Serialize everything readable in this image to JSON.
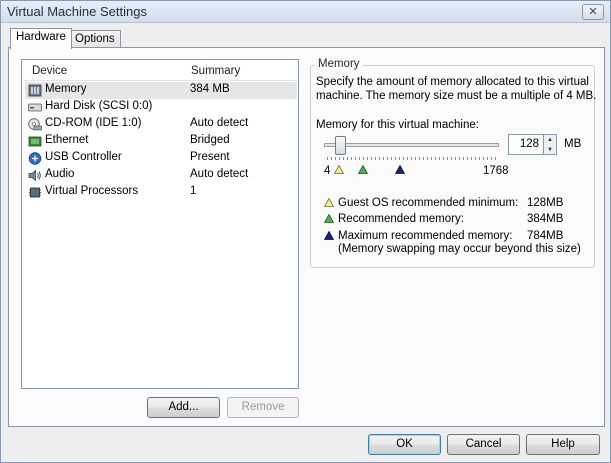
{
  "window": {
    "title": "Virtual Machine Settings",
    "close_glyph": "✕"
  },
  "tabs": [
    {
      "label": "Hardware",
      "active": true
    },
    {
      "label": "Options",
      "active": false
    }
  ],
  "device_list": {
    "columns": {
      "device": "Device",
      "summary": "Summary"
    },
    "rows": [
      {
        "name": "Memory",
        "summary": "384 MB",
        "icon": "memory-icon",
        "selected": true
      },
      {
        "name": "Hard Disk (SCSI 0:0)",
        "summary": "",
        "icon": "hard-disk-icon"
      },
      {
        "name": "CD-ROM (IDE 1:0)",
        "summary": "Auto detect",
        "icon": "cdrom-icon"
      },
      {
        "name": "Ethernet",
        "summary": "Bridged",
        "icon": "ethernet-icon"
      },
      {
        "name": "USB Controller",
        "summary": "Present",
        "icon": "usb-icon"
      },
      {
        "name": "Audio",
        "summary": "Auto detect",
        "icon": "audio-icon"
      },
      {
        "name": "Virtual Processors",
        "summary": "1",
        "icon": "processor-icon"
      }
    ]
  },
  "buttons": {
    "add": "Add...",
    "remove": "Remove",
    "ok": "OK",
    "cancel": "Cancel",
    "help": "Help"
  },
  "memory": {
    "group_label": "Memory",
    "description_line1": "Specify the amount of memory allocated to this virtual",
    "description_line2": "machine. The memory size must be a multiple of 4 MB.",
    "field_label": "Memory for this virtual machine:",
    "value": "128",
    "unit": "MB",
    "slider_min": "4",
    "slider_max": "1768",
    "slider_value": 128,
    "legend": [
      {
        "label": "Guest OS recommended minimum:",
        "value": "128MB",
        "color": "#f5ec8a"
      },
      {
        "label": "Recommended memory:",
        "value": "384MB",
        "color": "#4cb04c"
      },
      {
        "label": "Maximum recommended memory:",
        "value": "784MB",
        "color": "#1a237e"
      }
    ],
    "note": "(Memory swapping may occur beyond this size)"
  }
}
